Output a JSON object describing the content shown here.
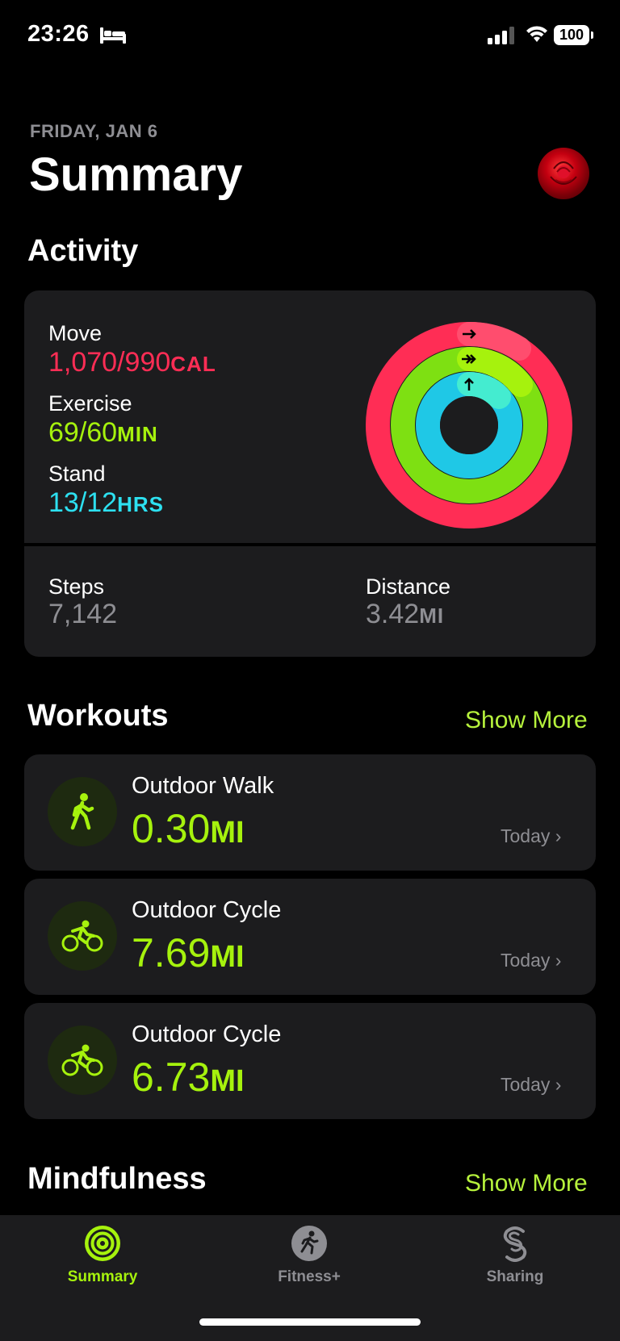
{
  "status_bar": {
    "time": "23:26",
    "battery": "100"
  },
  "header": {
    "date": "FRIDAY, JAN 6",
    "title": "Summary"
  },
  "activity": {
    "section_title": "Activity",
    "move": {
      "label": "Move",
      "value": "1,070/990",
      "unit": "CAL"
    },
    "exercise": {
      "label": "Exercise",
      "value": "69/60",
      "unit": "MIN"
    },
    "stand": {
      "label": "Stand",
      "value": "13/12",
      "unit": "HRS"
    },
    "steps": {
      "label": "Steps",
      "value": "7,142"
    },
    "distance": {
      "label": "Distance",
      "value": "3.42",
      "unit": "MI"
    },
    "ring_progress": {
      "move": 1.081,
      "exercise": 1.15,
      "stand": 1.083
    },
    "colors": {
      "move": "#ff2d55",
      "exercise": "#a6f20d",
      "stand": "#2de0f0"
    }
  },
  "workouts": {
    "section_title": "Workouts",
    "show_more": "Show More",
    "items": [
      {
        "name": "Outdoor Walk",
        "value": "0.30",
        "unit": "MI",
        "date": "Today",
        "icon": "walk-icon"
      },
      {
        "name": "Outdoor Cycle",
        "value": "7.69",
        "unit": "MI",
        "date": "Today",
        "icon": "cycle-icon"
      },
      {
        "name": "Outdoor Cycle",
        "value": "6.73",
        "unit": "MI",
        "date": "Today",
        "icon": "cycle-icon"
      }
    ]
  },
  "mindfulness": {
    "section_title": "Mindfulness",
    "show_more": "Show More"
  },
  "tabs": [
    {
      "label": "Summary",
      "active": true
    },
    {
      "label": "Fitness+",
      "active": false
    },
    {
      "label": "Sharing",
      "active": false
    }
  ]
}
